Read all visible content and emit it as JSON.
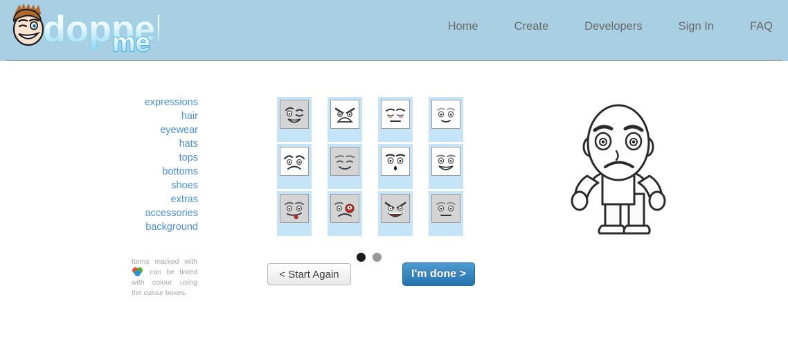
{
  "site": {
    "logo_text": "doppelme",
    "logo_primary": "doppel",
    "logo_secondary": "me",
    "logo_icon": "winking-face-avatar-icon",
    "header_bg": "#a9cfe2"
  },
  "nav": {
    "items": [
      {
        "label": "Home",
        "name": "nav-home"
      },
      {
        "label": "Create",
        "name": "nav-create"
      },
      {
        "label": "Developers",
        "name": "nav-developers"
      },
      {
        "label": "Sign In",
        "name": "nav-sign-in"
      },
      {
        "label": "FAQ",
        "name": "nav-faq"
      }
    ]
  },
  "sidebar": {
    "items": [
      {
        "label": "expressions",
        "selected": true
      },
      {
        "label": "hair",
        "selected": false
      },
      {
        "label": "eyewear",
        "selected": false
      },
      {
        "label": "hats",
        "selected": false
      },
      {
        "label": "tops",
        "selected": false
      },
      {
        "label": "bottoms",
        "selected": false
      },
      {
        "label": "shoes",
        "selected": false
      },
      {
        "label": "extras",
        "selected": false
      },
      {
        "label": "accessories",
        "selected": false
      },
      {
        "label": "background",
        "selected": false
      }
    ],
    "link_color": "#4a90d9"
  },
  "tint_note": {
    "text_before": "Items marked with",
    "icon": "colour-palette-icon",
    "text_after": "can be tinted with colour using the colour boxes.",
    "icon_colors": {
      "red": "#e8542f",
      "green": "#5aab2b",
      "blue": "#2f8ed4"
    }
  },
  "grid": {
    "category": "expressions",
    "columns": 4,
    "rows": 3,
    "cell_bg": "#c6e4f7",
    "selected_thumb_bg": "#d4d4d4",
    "items": [
      {
        "id": 1,
        "name": "expression-winking-smile",
        "selected": true
      },
      {
        "id": 2,
        "name": "expression-angry-frown",
        "selected": false
      },
      {
        "id": 3,
        "name": "expression-tired-blush",
        "selected": false
      },
      {
        "id": 4,
        "name": "expression-neutral-smile",
        "selected": false
      },
      {
        "id": 5,
        "name": "expression-worried-sad",
        "selected": false
      },
      {
        "id": 6,
        "name": "expression-content-smile",
        "selected": true
      },
      {
        "id": 7,
        "name": "expression-surprised-oh",
        "selected": false
      },
      {
        "id": 8,
        "name": "expression-big-grin",
        "selected": false
      },
      {
        "id": 9,
        "name": "expression-tongue-out",
        "selected": true
      },
      {
        "id": 10,
        "name": "expression-black-eye",
        "selected": true
      },
      {
        "id": 11,
        "name": "expression-evil-grin",
        "selected": true
      },
      {
        "id": 12,
        "name": "expression-blank-stare",
        "selected": true
      }
    ]
  },
  "pager": {
    "pages": 2,
    "current": 1,
    "active_color": "#1b1b1b",
    "inactive_color": "#989898"
  },
  "buttons": {
    "start_again": "< Start Again",
    "done": "I'm done >",
    "done_color": "#2573ae"
  },
  "avatar": {
    "name": "avatar-preview",
    "description": "bald cartoon character with worried expression, white t-shirt, light trousers and shoes"
  }
}
